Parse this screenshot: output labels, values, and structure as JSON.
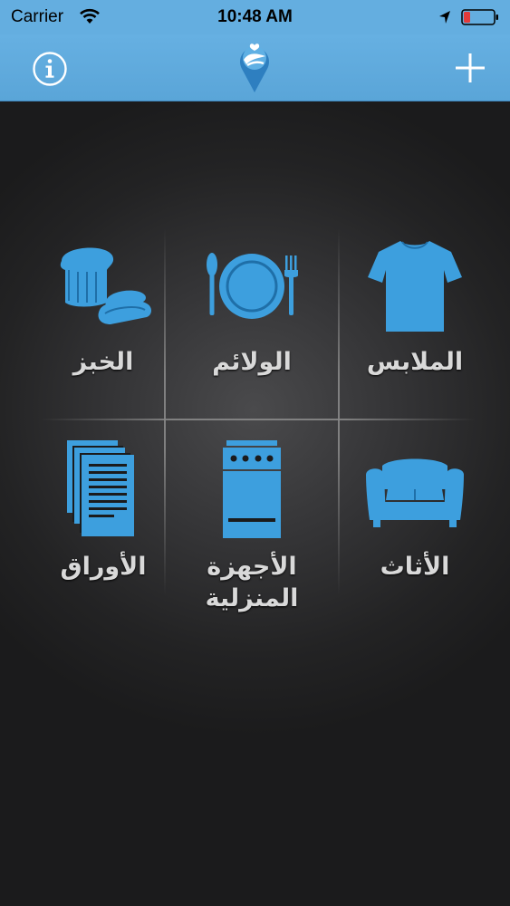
{
  "status_bar": {
    "carrier": "Carrier",
    "time": "10:48 AM"
  },
  "colors": {
    "accent": "#3d9fde",
    "header": "#64aee0",
    "battery_low": "#e33b3b",
    "label": "#d9d9d9"
  },
  "nav": {
    "info_icon": "info-circle-icon",
    "logo_icon": "hand-heart-logo-icon",
    "add_icon": "plus-icon"
  },
  "categories": [
    {
      "label": "الملابس",
      "icon": "tshirt-icon"
    },
    {
      "label": "الولائم",
      "icon": "plate-cutlery-icon"
    },
    {
      "label": "الخبز",
      "icon": "bread-icon"
    },
    {
      "label": "الأثاث",
      "icon": "sofa-icon"
    },
    {
      "label": "الأجهزة المنزلية",
      "icon": "stove-icon"
    },
    {
      "label": "الأوراق",
      "icon": "papers-icon"
    }
  ]
}
